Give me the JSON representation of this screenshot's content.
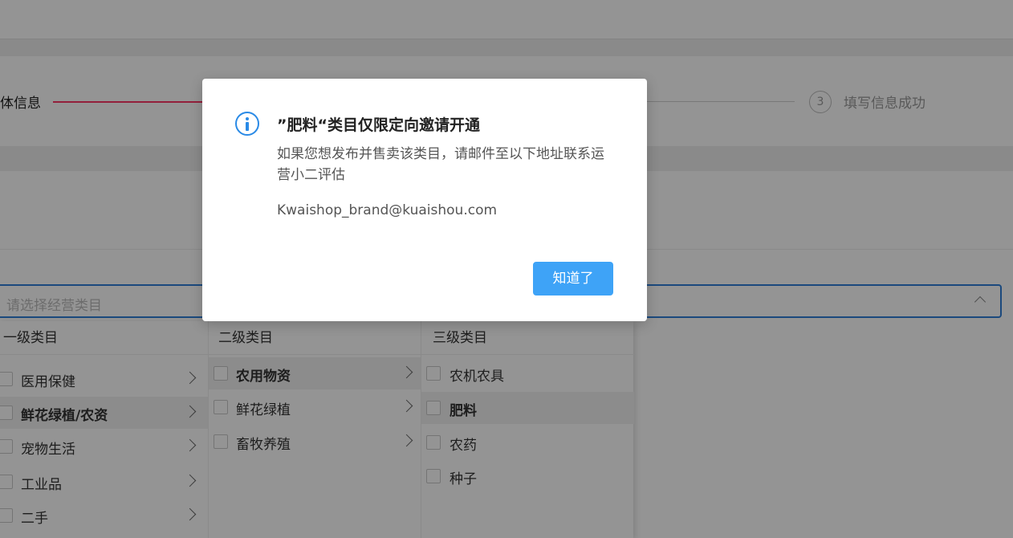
{
  "steps": {
    "step1_label": "体信息",
    "step3_number": "3",
    "step3_label": "填写信息成功"
  },
  "select": {
    "placeholder": "请选择经营类目"
  },
  "cascader": {
    "level1": {
      "header": "一级类目",
      "items": [
        {
          "label": "医用保健",
          "selected": false
        },
        {
          "label": "鲜花绿植/农资",
          "selected": true
        },
        {
          "label": "宠物生活",
          "selected": false
        },
        {
          "label": "工业品",
          "selected": false
        },
        {
          "label": "二手",
          "selected": false
        }
      ]
    },
    "level2": {
      "header": "二级类目",
      "items": [
        {
          "label": "农用物资",
          "selected": true
        },
        {
          "label": "鲜花绿植",
          "selected": false
        },
        {
          "label": "畜牧养殖",
          "selected": false
        }
      ]
    },
    "level3": {
      "header": "三级类目",
      "items": [
        {
          "label": "农机农具",
          "selected": false
        },
        {
          "label": "肥料",
          "selected": true
        },
        {
          "label": "农药",
          "selected": false
        },
        {
          "label": "种子",
          "selected": false
        }
      ]
    }
  },
  "modal": {
    "title": "”肥料“类目仅限定向邀请开通",
    "body": "如果您想发布并售卖该类目，请邮件至以下地址联系运营小二评估",
    "email": "Kwaishop_brand@kuaishou.com",
    "ok_label": "知道了"
  },
  "colors": {
    "accent": "#3ea3f7",
    "info_icon": "#2a8ae6",
    "step_active": "#fe3666",
    "select_border": "#2f7fd8"
  },
  "icons": {
    "info": "info-circle-icon",
    "arrow": "chevron-right-icon",
    "select_toggle": "chevron-up-icon"
  }
}
